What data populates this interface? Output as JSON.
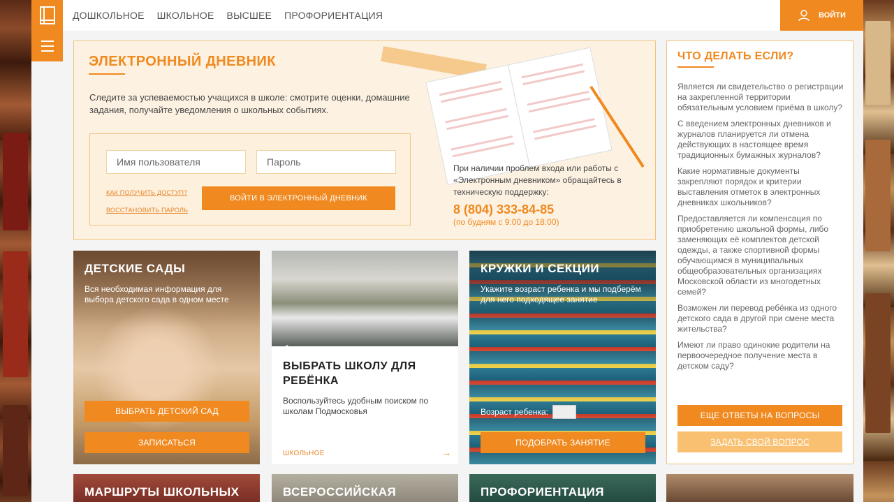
{
  "nav": {
    "items": [
      "ДОШКОЛЬНОЕ",
      "ШКОЛЬНОЕ",
      "ВЫСШЕЕ",
      "ПРОФОРИЕНТАЦИЯ"
    ],
    "login_label": "ВОЙТИ"
  },
  "diary": {
    "title": "ЭЛЕКТРОННЫЙ ДНЕВНИК",
    "description": "Следите за успеваемостью учащихся в школе: смотрите оценки, домашние задания, получайте уведомления о школьных событиях.",
    "username_placeholder": "Имя пользователя",
    "password_placeholder": "Пароль",
    "get_access_link": "КАК ПОЛУЧИТЬ ДОСТУП?",
    "restore_link": "ВОССТАНОВИТЬ ПАРОЛЬ",
    "submit_label": "ВОЙТИ В ЭЛЕКТРОННЫЙ ДНЕВНИК",
    "support_text": "При наличии проблем входа или работы с «Электронным дневником» обращайтесь в техническую поддержку:",
    "phone": "8 (804) 333-84-85",
    "hours": "(по будням с 9:00 до 18:00)"
  },
  "faq": {
    "title": "ЧТО ДЕЛАТЬ ЕСЛИ?",
    "questions": [
      "Является ли свидетельство о регистрации на закрепленной территории обязательным условием приёма в школу?",
      "С введением электронных дневников и журналов планируется ли отмена действующих в настоящее время традиционных бумажных журналов?",
      "Какие нормативные документы закрепляют порядок и критерии выставления отметок в электронных дневниках школьников?",
      "Предоставляется ли компенсация по приобретению школьной формы, либо заменяющих её комплектов детской одежды, а также спортивной формы обучающимся в муниципальных общеобразовательных организациях Московской области из многодетных семей?",
      "Возможен ли перевод ребёнка из одного детского сада в другой при смене места жительства?",
      "Имеют ли право одинокие родители на первоочередное получение места в детском саду?"
    ],
    "more_label": "ЕЩЕ ОТВЕТЫ НА ВОПРОСЫ",
    "ask_label": "ЗАДАТЬ СВОЙ ВОПРОС"
  },
  "cards": {
    "kids": {
      "title": "ДЕТСКИЕ САДЫ",
      "subtitle": "Вся необходимая информация для выбора детского сада в одном месте",
      "choose_label": "ВЫБРАТЬ ДЕТСКИЙ САД",
      "enroll_label": "ЗАПИСАТЬСЯ"
    },
    "school": {
      "title": "ВЫБРАТЬ ШКОЛУ ДЛЯ РЕБЁНКА",
      "subtitle": "Воспользуйтесь удобным поиском по школам Подмосковья",
      "tag": "ШКОЛЬНОЕ",
      "arrow": "→"
    },
    "clubs": {
      "title": "КРУЖКИ И СЕКЦИИ",
      "subtitle": "Укажите возраст ребенка и мы подберём для него подходящее занятие",
      "age_label": "Возраст ребенка:",
      "pick_label": "ПОДОБРАТЬ ЗАНЯТИЕ"
    }
  },
  "bottom_cards": [
    "МАРШРУТЫ ШКОЛЬНЫХ",
    "ВСЕРОССИЙСКАЯ",
    "ПРОФОРИЕНТАЦИЯ"
  ],
  "colors": {
    "accent": "#f0891f",
    "panel": "#fdf2e2",
    "border": "#f1c27f"
  }
}
